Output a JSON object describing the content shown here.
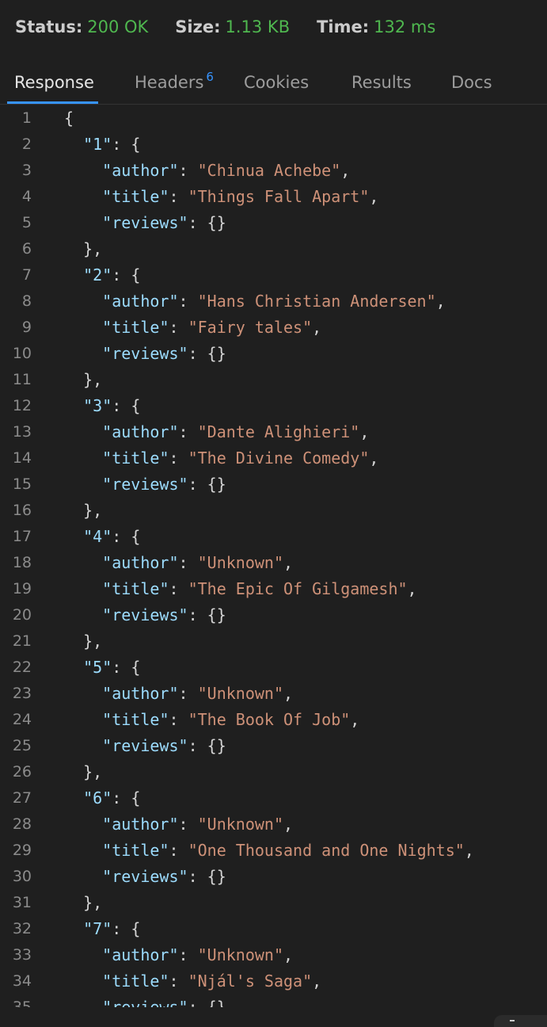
{
  "status": {
    "status_label": "Status:",
    "status_value": "200 OK",
    "size_label": "Size:",
    "size_value": "1.13 KB",
    "time_label": "Time:",
    "time_value": "132 ms"
  },
  "tabs": [
    {
      "label": "Response",
      "active": true
    },
    {
      "label": "Headers",
      "badge": "6"
    },
    {
      "label": "Cookies"
    },
    {
      "label": "Results"
    },
    {
      "label": "Docs"
    }
  ],
  "colors": {
    "accent": "#3794ff",
    "status_ok": "#4fb74f",
    "json_key": "#9cdcfe",
    "json_string": "#ce9178",
    "background": "#1f1f1f"
  },
  "response_books": [
    {
      "id": "1",
      "author": "Chinua Achebe",
      "title": "Things Fall Apart",
      "reviews": "{}"
    },
    {
      "id": "2",
      "author": "Hans Christian Andersen",
      "title": "Fairy tales",
      "reviews": "{}"
    },
    {
      "id": "3",
      "author": "Dante Alighieri",
      "title": "The Divine Comedy",
      "reviews": "{}"
    },
    {
      "id": "4",
      "author": "Unknown",
      "title": "The Epic Of Gilgamesh",
      "reviews": "{}"
    },
    {
      "id": "5",
      "author": "Unknown",
      "title": "The Book Of Job",
      "reviews": "{}"
    },
    {
      "id": "6",
      "author": "Unknown",
      "title": "One Thousand and One Nights",
      "reviews": "{}"
    },
    {
      "id": "7",
      "author": "Unknown",
      "title": "Njál's Saga",
      "reviews": "{}"
    }
  ],
  "json_keys": {
    "author": "author",
    "title": "title",
    "reviews": "reviews"
  }
}
